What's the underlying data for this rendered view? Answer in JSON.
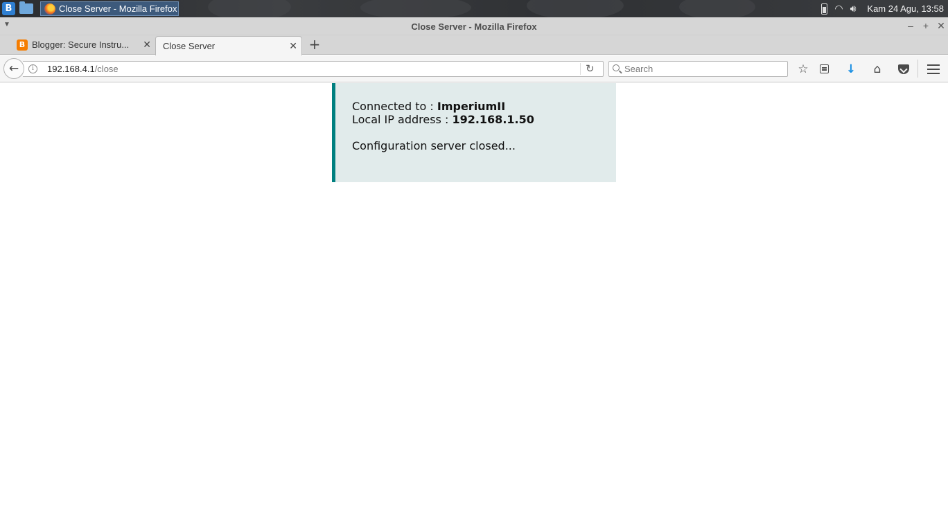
{
  "taskbar": {
    "launcher_icon": "bodhi-launcher-icon",
    "window_title": "Close Server - Mozilla Firefox",
    "clock": "Kam 24 Agu, 13:58"
  },
  "window": {
    "title": "Close Server - Mozilla Firefox"
  },
  "tabs": [
    {
      "label": "Blogger: Secure Instru...",
      "icon": "blogger-icon",
      "active": false
    },
    {
      "label": "Close Server",
      "active": true
    }
  ],
  "navbar": {
    "url_host": "192.168.4.1",
    "url_path": "/close",
    "search_placeholder": "Search"
  },
  "page": {
    "connected_label": "Connected to : ",
    "connected_value": "ImperiumII",
    "ip_label": "Local IP address : ",
    "ip_value": "192.168.1.50",
    "message": "Configuration server closed..."
  },
  "colors": {
    "accent_border": "#008080",
    "box_background": "#e1ebeb",
    "download_icon": "#1a8fe3"
  }
}
